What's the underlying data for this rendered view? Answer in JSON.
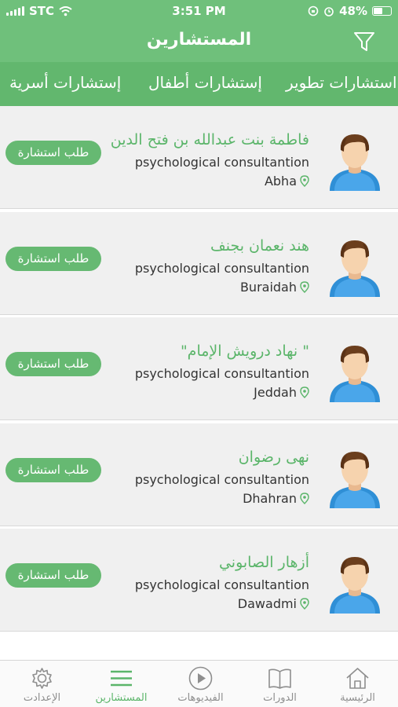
{
  "status_bar": {
    "carrier": "STC",
    "time": "3:51 PM",
    "battery": "48%"
  },
  "header": {
    "title": "المستشارين"
  },
  "tabs": [
    "إستشارات أسرية",
    "إستشارات أطفال",
    "استشارات تطوير"
  ],
  "consultants": [
    {
      "name": "فاطمة بنت عبدالله بن فتح الدين",
      "specialty": "psychological consultantion",
      "city": "Abha",
      "button": "طلب استشارة"
    },
    {
      "name": "هند نعمان بجنف",
      "specialty": "psychological consultantion",
      "city": "Buraidah",
      "button": "طلب استشارة"
    },
    {
      "name": "\" نهاد درويش الإمام\"",
      "specialty": "psychological consultantion",
      "city": "Jeddah",
      "button": "طلب استشارة"
    },
    {
      "name": "نهى رضوان",
      "specialty": "psychological consultantion",
      "city": "Dhahran",
      "button": "طلب استشارة"
    },
    {
      "name": "أزهار الصابوني",
      "specialty": "psychological consultantion",
      "city": "Dawadmi",
      "button": "طلب استشارة"
    }
  ],
  "tabbar": {
    "settings": "الإعدادت",
    "consultants": "المستشارين",
    "videos": "الفيديوهات",
    "courses": "الدورات",
    "home": "الرئيسية"
  },
  "colors": {
    "accent": "#6fc07b",
    "tab_bg": "#62b76e",
    "name_text": "#5bb56a"
  },
  "icons": [
    "filter-icon",
    "settings-icon",
    "list-icon",
    "play-icon",
    "book-icon",
    "home-icon",
    "location-pin-icon",
    "avatar-icon"
  ]
}
